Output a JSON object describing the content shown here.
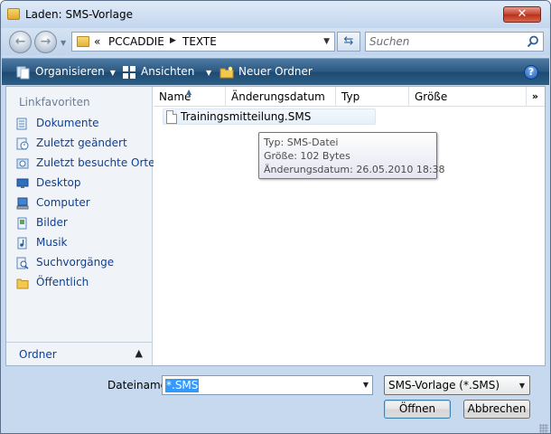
{
  "window": {
    "title": "Laden: SMS-Vorlage",
    "close_glyph": "✕"
  },
  "address": {
    "overflow": "«",
    "segments": [
      "PCCADDIE",
      "TEXTE"
    ],
    "search_placeholder": "Suchen"
  },
  "toolbar": {
    "organize_label": "Organisieren",
    "views_label": "Ansichten",
    "new_folder_label": "Neuer Ordner",
    "help_glyph": "?"
  },
  "nav_pane": {
    "heading": "Linkfavoriten",
    "items": [
      {
        "label": "Dokumente",
        "icon": "documents-icon"
      },
      {
        "label": "Zuletzt geändert",
        "icon": "recent-changed-icon"
      },
      {
        "label": "Zuletzt besuchte Orte",
        "icon": "recent-places-icon"
      },
      {
        "label": "Desktop",
        "icon": "desktop-icon"
      },
      {
        "label": "Computer",
        "icon": "computer-icon"
      },
      {
        "label": "Bilder",
        "icon": "pictures-icon"
      },
      {
        "label": "Musik",
        "icon": "music-icon"
      },
      {
        "label": "Suchvorgänge",
        "icon": "searches-icon"
      },
      {
        "label": "Öffentlich",
        "icon": "public-folder-icon"
      }
    ],
    "folders_label": "Ordner"
  },
  "file_list": {
    "columns": [
      "Name",
      "Änderungsdatum",
      "Typ",
      "Größe"
    ],
    "more_columns": "»",
    "files": [
      {
        "name": "Trainingsmitteilung.SMS"
      }
    ],
    "tooltip": {
      "type_line": "Typ: SMS-Datei",
      "size_line": "Größe: 102 Bytes",
      "date_line": "Änderungsdatum: 26.05.2010 18:38"
    }
  },
  "bottom": {
    "filename_label": "Dateiname:",
    "filename_value": "*.SMS",
    "filetype_value": "SMS-Vorlage (*.SMS)",
    "open_label": "Öffnen",
    "cancel_label": "Abbrechen"
  },
  "colors": {
    "toolbar_blue": "#2a5780",
    "link_blue": "#0c3f99",
    "selection_blue": "#3399ff",
    "close_red": "#c4412c"
  }
}
